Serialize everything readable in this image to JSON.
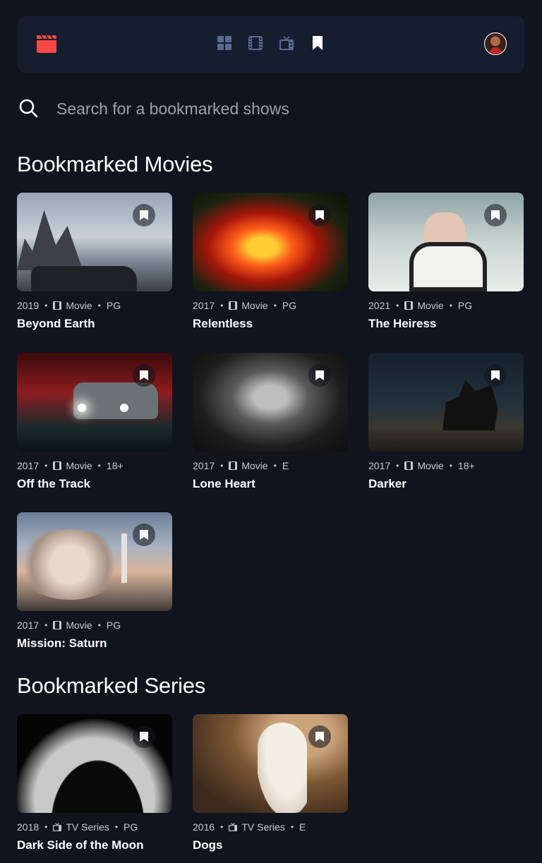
{
  "nav": {
    "logo_icon": "clapperboard-icon",
    "accent": "#fc4747",
    "icons": [
      "home-grid-icon",
      "movies-film-icon",
      "tv-series-icon",
      "bookmark-icon"
    ],
    "active": "bookmark-icon"
  },
  "search": {
    "placeholder": "Search for a bookmarked shows",
    "value": ""
  },
  "movies": {
    "heading": "Bookmarked Movies",
    "items": [
      {
        "year": "2019",
        "category": "Movie",
        "rating": "PG",
        "title": "Beyond Earth"
      },
      {
        "year": "2017",
        "category": "Movie",
        "rating": "PG",
        "title": "Relentless"
      },
      {
        "year": "2021",
        "category": "Movie",
        "rating": "PG",
        "title": "The Heiress"
      },
      {
        "year": "2017",
        "category": "Movie",
        "rating": "18+",
        "title": "Off the Track"
      },
      {
        "year": "2017",
        "category": "Movie",
        "rating": "E",
        "title": "Lone Heart"
      },
      {
        "year": "2017",
        "category": "Movie",
        "rating": "18+",
        "title": "Darker"
      },
      {
        "year": "2017",
        "category": "Movie",
        "rating": "PG",
        "title": "Mission: Saturn"
      }
    ]
  },
  "series": {
    "heading": "Bookmarked Series",
    "items": [
      {
        "year": "2018",
        "category": "TV Series",
        "rating": "PG",
        "title": "Dark Side of the Moon"
      },
      {
        "year": "2016",
        "category": "TV Series",
        "rating": "E",
        "title": "Dogs"
      }
    ]
  },
  "colors": {
    "background": "#10141e",
    "surface": "#161d2f",
    "nav_inactive": "#5a698f"
  }
}
